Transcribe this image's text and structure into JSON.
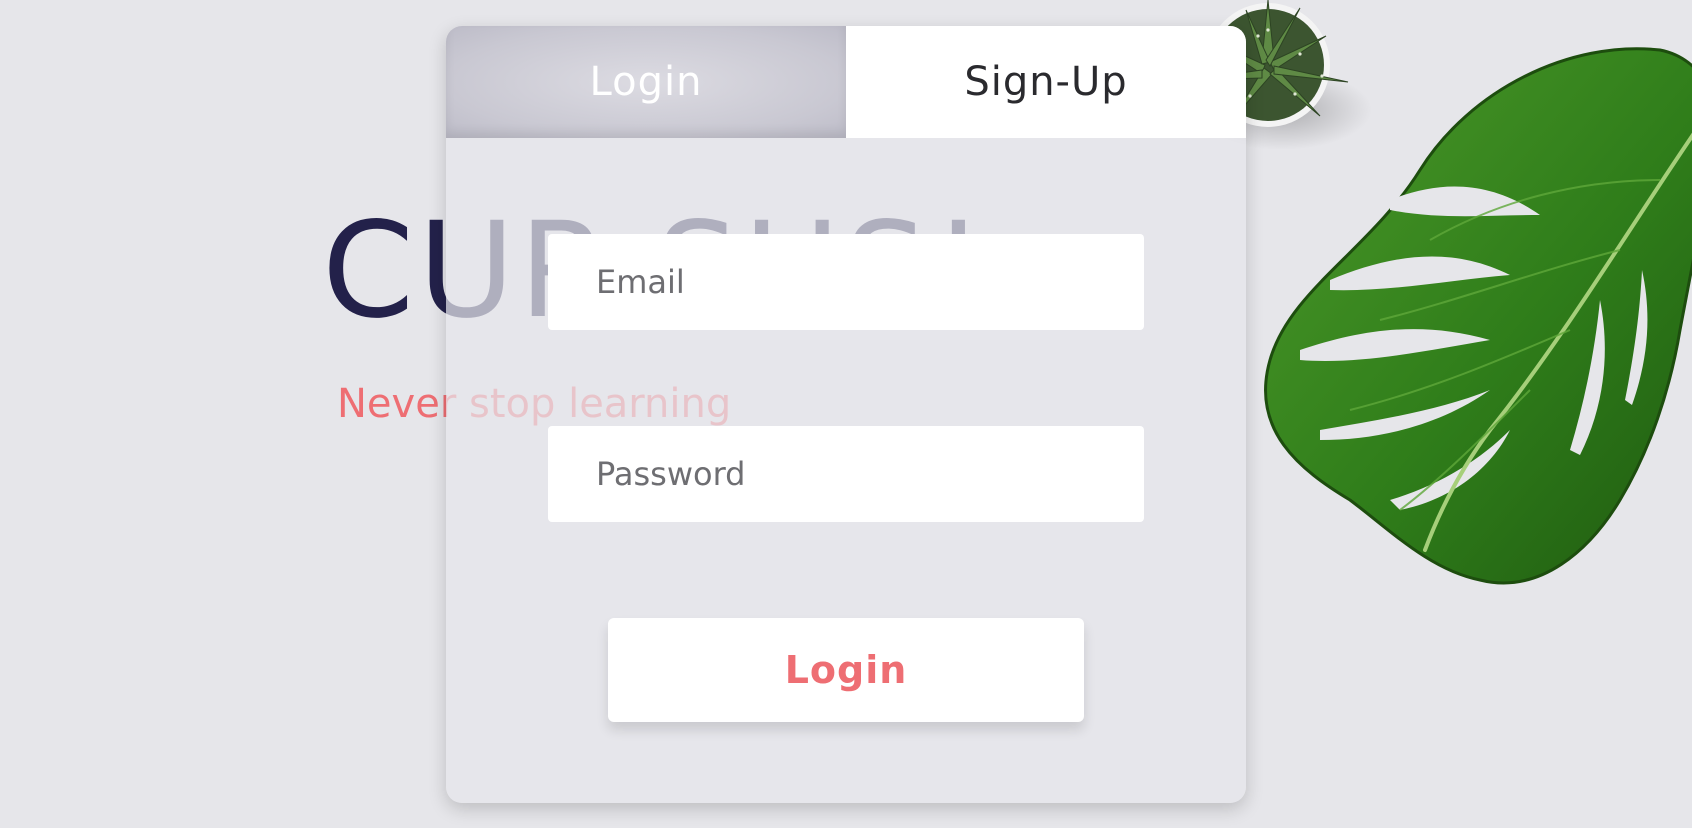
{
  "brand": {
    "title": "CUR.SUS!",
    "tagline": "Never stop learning"
  },
  "tabs": [
    {
      "label": "Login",
      "active": true
    },
    {
      "label": "Sign-Up",
      "active": false
    }
  ],
  "form": {
    "email_placeholder": "Email",
    "password_placeholder": "Password",
    "submit_label": "Login"
  },
  "colors": {
    "background": "#e6e6ea",
    "brand_title": "#23214a",
    "accent": "#ee6e73",
    "active_tab": "#c9c8d2",
    "leaf_green": "#2f7d1a"
  },
  "decor": {
    "plants": [
      "succulent-pot",
      "monstera-leaf"
    ]
  }
}
